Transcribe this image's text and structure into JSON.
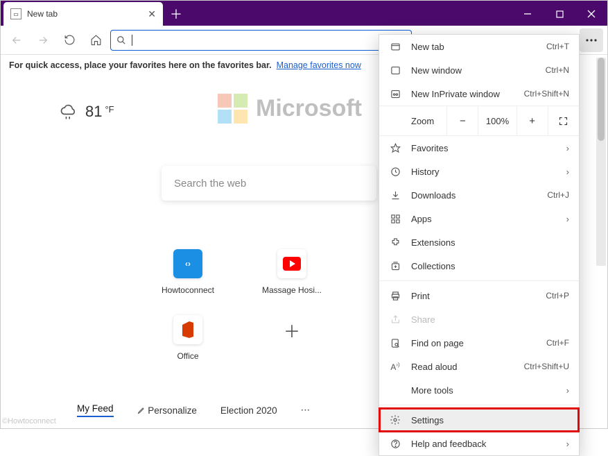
{
  "tab": {
    "title": "New tab"
  },
  "favbar": {
    "text": "For quick access, place your favorites here on the favorites bar.",
    "link": "Manage favorites now"
  },
  "weather": {
    "temp": "81",
    "unit": "°F"
  },
  "logo_text": "Microsoft",
  "search_placeholder": "Search the web",
  "tiles": [
    {
      "label": "Howtoconnect"
    },
    {
      "label": "Massage Hosi..."
    },
    {
      "label": "YouTube"
    }
  ],
  "tiles2": [
    {
      "label": "Office"
    }
  ],
  "bottomnav": {
    "feed": "My Feed",
    "personalize": "Personalize",
    "election": "Election 2020"
  },
  "zoom": {
    "label": "Zoom",
    "value": "100%"
  },
  "menu": {
    "new_tab": "New tab",
    "new_tab_sc": "Ctrl+T",
    "new_window": "New window",
    "new_window_sc": "Ctrl+N",
    "new_inprivate": "New InPrivate window",
    "new_inprivate_sc": "Ctrl+Shift+N",
    "favorites": "Favorites",
    "history": "History",
    "downloads": "Downloads",
    "downloads_sc": "Ctrl+J",
    "apps": "Apps",
    "extensions": "Extensions",
    "collections": "Collections",
    "print": "Print",
    "print_sc": "Ctrl+P",
    "share": "Share",
    "find": "Find on page",
    "find_sc": "Ctrl+F",
    "read_aloud": "Read aloud",
    "read_aloud_sc": "Ctrl+Shift+U",
    "more_tools": "More tools",
    "settings": "Settings",
    "help": "Help and feedback"
  },
  "watermark": "©Howtoconnect"
}
